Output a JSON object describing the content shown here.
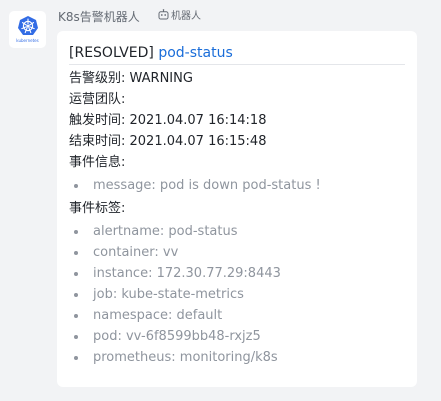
{
  "sender": {
    "name": "K8s告警机器人",
    "bot_tag": "机器人",
    "avatar_text": "kubernetes",
    "avatar_icon": "kubernetes-logo",
    "avatar_color": "#326ce5"
  },
  "card": {
    "status": "[RESOLVED]",
    "alert_link": "pod-status",
    "link_color": "#1a6dd9",
    "level": "告警级别: WARNING",
    "team": "运营团队:",
    "start_time": "触发时间: 2021.04.07 16:14:18",
    "end_time": "结束时间: 2021.04.07 16:15:48",
    "event_info_label": "事件信息:",
    "event_info": [
      "message: pod is down pod-status !"
    ],
    "event_labels_label": "事件标签:",
    "event_labels": [
      "alertname: pod-status",
      "container: vv",
      "instance: 172.30.77.29:8443",
      "job: kube-state-metrics",
      "namespace: default",
      "pod: vv-6f8599bb48-rxjz5",
      "prometheus: monitoring/k8s"
    ]
  }
}
